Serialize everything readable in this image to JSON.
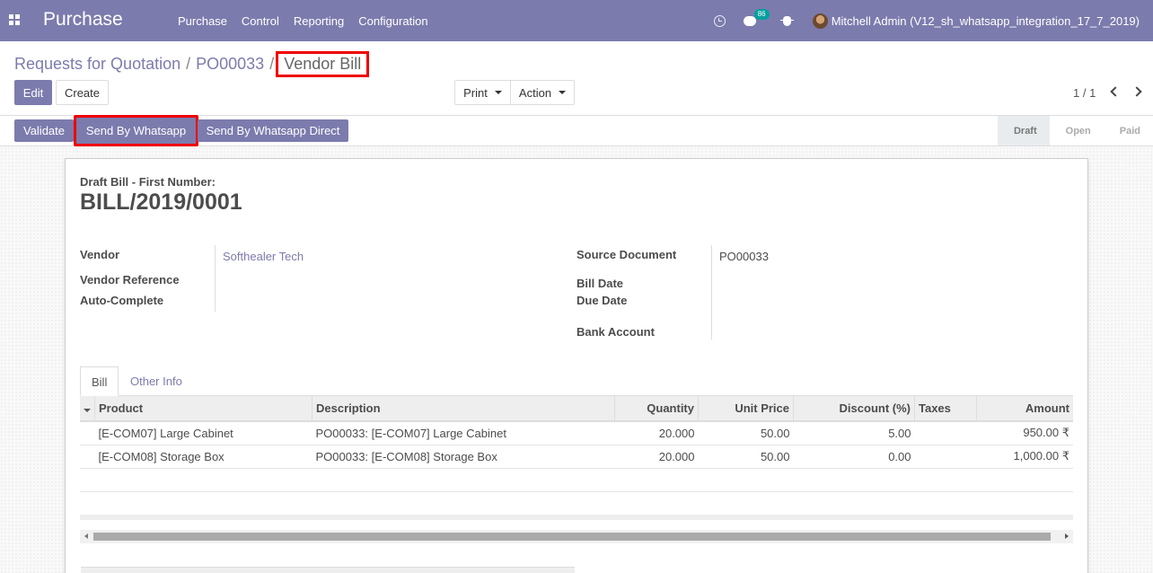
{
  "app": {
    "title": "Purchase",
    "menu": [
      "Purchase",
      "Control",
      "Reporting",
      "Configuration"
    ]
  },
  "navbar": {
    "messages_count": "86",
    "user_name": "Mitchell Admin (V12_sh_whatsapp_integration_17_7_2019)"
  },
  "breadcrumb": {
    "root": "Requests for Quotation",
    "parent": "PO00033",
    "current": "Vendor Bill",
    "sep": "/"
  },
  "control": {
    "edit": "Edit",
    "create": "Create",
    "print": "Print",
    "action": "Action",
    "pager": "1 / 1"
  },
  "statusbar": {
    "buttons": [
      "Validate",
      "Send By Whatsapp",
      "Send By Whatsapp Direct"
    ],
    "stages": [
      "Draft",
      "Open",
      "Paid"
    ],
    "active_stage": "Draft"
  },
  "bill": {
    "subtitle": "Draft Bill - First Number:",
    "number": "BILL/2019/0001",
    "fields_left": [
      {
        "label": "Vendor",
        "value": "Softhealer Tech"
      },
      {
        "label": "Vendor Reference",
        "value": ""
      },
      {
        "label": "Auto-Complete",
        "value": ""
      }
    ],
    "fields_right": [
      {
        "label": "Source Document",
        "value": "PO00033"
      },
      {
        "label": "Bill Date",
        "value": ""
      },
      {
        "label": "Due Date",
        "value": ""
      },
      {
        "label": "Bank Account",
        "value": ""
      }
    ]
  },
  "tabs": [
    "Bill",
    "Other Info"
  ],
  "lines": {
    "headers": [
      "Product",
      "Description",
      "Quantity",
      "Unit Price",
      "Discount (%)",
      "Taxes",
      "Amount"
    ],
    "rows": [
      {
        "product": "[E-COM07] Large Cabinet",
        "description": "PO00033: [E-COM07] Large Cabinet",
        "quantity": "20.000",
        "unit_price": "50.00",
        "discount": "5.00",
        "taxes": "",
        "amount": "950.00 ₹"
      },
      {
        "product": "[E-COM08] Storage Box",
        "description": "PO00033: [E-COM08] Storage Box",
        "quantity": "20.000",
        "unit_price": "50.00",
        "discount": "0.00",
        "taxes": "",
        "amount": "1,000.00 ₹"
      }
    ]
  },
  "colors": {
    "brand": "#7c7bad",
    "highlight": "#e00000"
  }
}
